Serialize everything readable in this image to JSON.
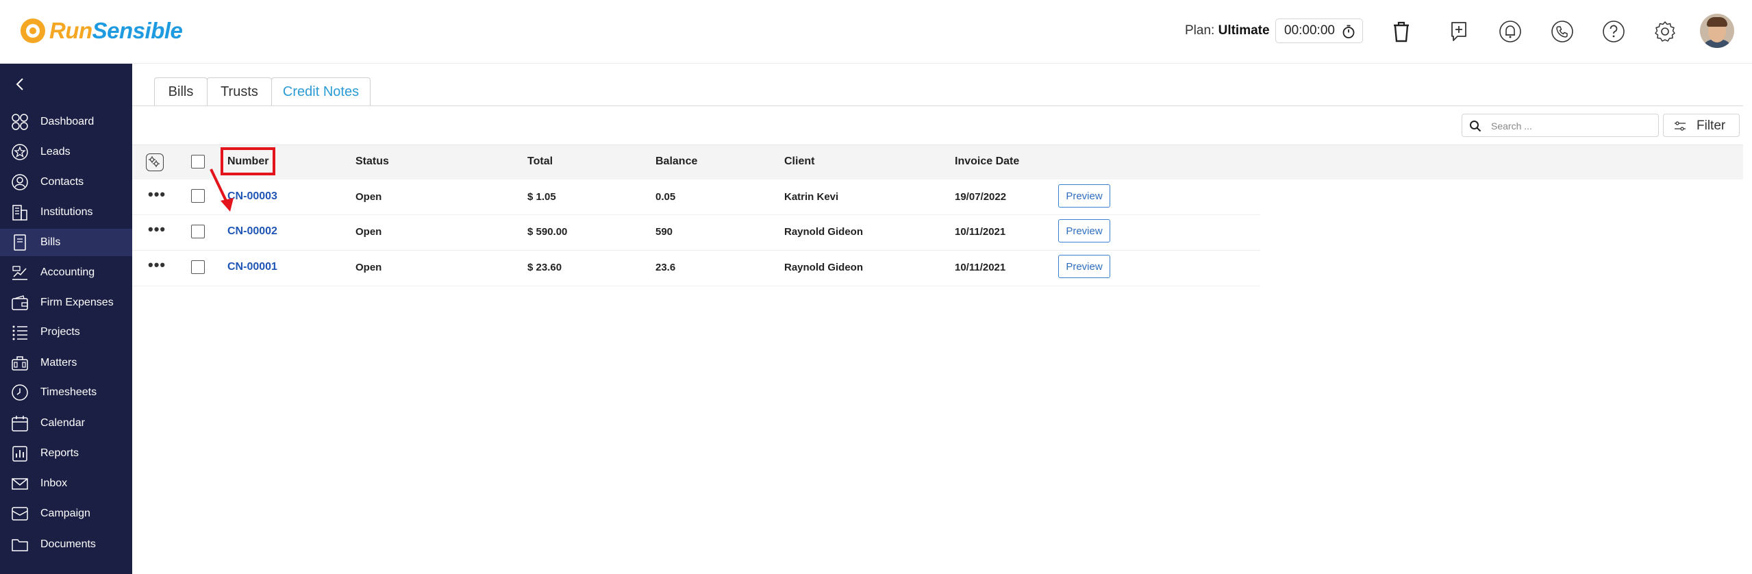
{
  "app": {
    "logo_run": "Run",
    "logo_sensible": "Sensible"
  },
  "header": {
    "plan_label": "Plan:",
    "plan_value": "Ultimate",
    "timer": "00:00:00",
    "icons": [
      "trash-icon",
      "add-call-icon",
      "bell-icon",
      "phone-icon",
      "help-icon",
      "gear-icon"
    ]
  },
  "sidebar": {
    "items": [
      {
        "label": "Dashboard",
        "icon": "dashboard-icon"
      },
      {
        "label": "Leads",
        "icon": "star-icon"
      },
      {
        "label": "Contacts",
        "icon": "contact-icon"
      },
      {
        "label": "Institutions",
        "icon": "building-icon"
      },
      {
        "label": "Bills",
        "icon": "bill-icon",
        "active": true
      },
      {
        "label": "Accounting",
        "icon": "accounting-icon"
      },
      {
        "label": "Firm Expenses",
        "icon": "wallet-icon"
      },
      {
        "label": "Projects",
        "icon": "list-icon"
      },
      {
        "label": "Matters",
        "icon": "briefcase-icon"
      },
      {
        "label": "Timesheets",
        "icon": "clock-icon"
      },
      {
        "label": "Calendar",
        "icon": "calendar-icon"
      },
      {
        "label": "Reports",
        "icon": "report-icon"
      },
      {
        "label": "Inbox",
        "icon": "mail-icon"
      },
      {
        "label": "Campaign",
        "icon": "campaign-icon"
      },
      {
        "label": "Documents",
        "icon": "folder-icon"
      }
    ]
  },
  "tabs": [
    {
      "label": "Bills"
    },
    {
      "label": "Trusts"
    },
    {
      "label": "Credit Notes",
      "active": true
    }
  ],
  "toolbar": {
    "search_placeholder": "Search ...",
    "filter_label": "Filter"
  },
  "table": {
    "columns": [
      "Number",
      "Status",
      "Total",
      "Balance",
      "Client",
      "Invoice Date"
    ],
    "rows": [
      {
        "number": "CN-00003",
        "status": "Open",
        "total": "$ 1.05",
        "balance": "0.05",
        "client": "Katrin Kevi",
        "date": "19/07/2022",
        "action": "Preview"
      },
      {
        "number": "CN-00002",
        "status": "Open",
        "total": "$ 590.00",
        "balance": "590",
        "client": "Raynold Gideon",
        "date": "10/11/2021",
        "action": "Preview"
      },
      {
        "number": "CN-00001",
        "status": "Open",
        "total": "$ 23.60",
        "balance": "23.6",
        "client": "Raynold Gideon",
        "date": "10/11/2021",
        "action": "Preview"
      }
    ]
  },
  "colors": {
    "sidebar_bg": "#1b1f44",
    "accent": "#2b9bd6",
    "link": "#1f56b5",
    "annotation": "#e3141b"
  }
}
